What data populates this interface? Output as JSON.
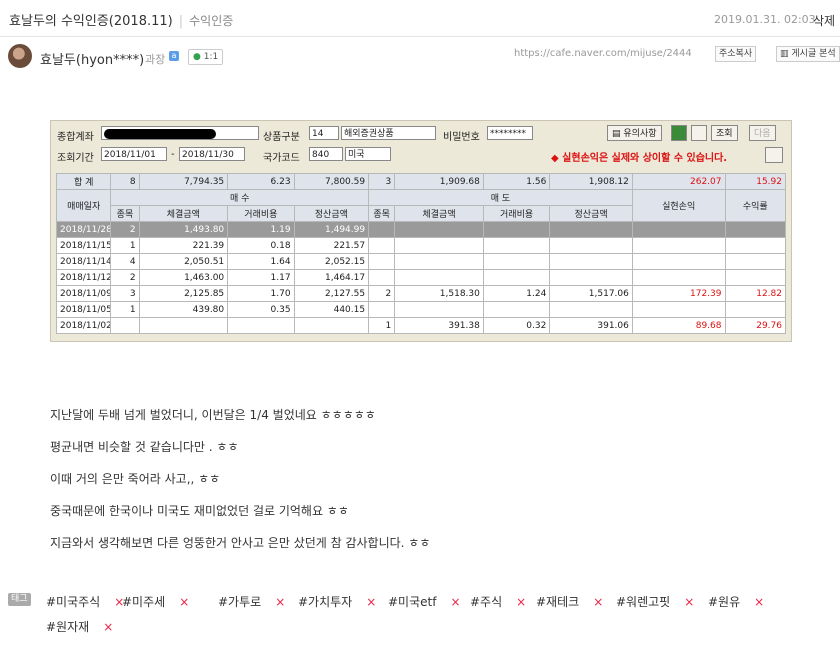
{
  "header": {
    "title": "효날두의 수익인증(2018.11)",
    "category": "수익인증",
    "date": "2019.01.31. 02:03",
    "delete_label": "삭제"
  },
  "author": {
    "name": "효날두(hyon****)",
    "rank": "과장",
    "badge": "a",
    "comment_count": "1:1",
    "url": "https://cafe.naver.com/mijuse/2444",
    "copy_url_label": "주소복사",
    "board_label": "게시글 본석"
  },
  "screenshot": {
    "account_label": "종합계좌",
    "product_label": "상품구분",
    "product_code": "14",
    "product_name": "해외증권상품",
    "password_label": "비밀번호",
    "password_value": "********",
    "notice_button": "유의사항",
    "query_button": "조회",
    "next_button": "다음",
    "period_label": "조회기간",
    "period_from": "2018/11/01",
    "period_to": "2018/11/30",
    "country_label": "국가코드",
    "country_code": "840",
    "country_name": "미국",
    "warning": "◆ 실현손익은 실제와 상이할 수 있습니다.",
    "summary": [
      "합 계",
      "8",
      "7,794.35",
      "6.23",
      "7,800.59",
      "3",
      "1,909.68",
      "1.56",
      "1,908.12",
      "262.07",
      "15.92"
    ],
    "buy_header": "매   수",
    "sell_header": "매   도",
    "col_date": "매매일자",
    "col_count": "종목",
    "col_amount": "체결금액",
    "col_fee": "거래비용",
    "col_settle": "정산금액",
    "col_pnl": "실현손익",
    "col_rate": "수익률",
    "rows": [
      [
        "2018/11/28",
        "2",
        "1,493.80",
        "1.19",
        "1,494.99",
        "",
        "",
        "",
        "",
        "",
        ""
      ],
      [
        "2018/11/15",
        "1",
        "221.39",
        "0.18",
        "221.57",
        "",
        "",
        "",
        "",
        "",
        ""
      ],
      [
        "2018/11/14",
        "4",
        "2,050.51",
        "1.64",
        "2,052.15",
        "",
        "",
        "",
        "",
        "",
        ""
      ],
      [
        "2018/11/12",
        "2",
        "1,463.00",
        "1.17",
        "1,464.17",
        "",
        "",
        "",
        "",
        "",
        ""
      ],
      [
        "2018/11/09",
        "3",
        "2,125.85",
        "1.70",
        "2,127.55",
        "2",
        "1,518.30",
        "1.24",
        "1,517.06",
        "172.39",
        "12.82"
      ],
      [
        "2018/11/05",
        "1",
        "439.80",
        "0.35",
        "440.15",
        "",
        "",
        "",
        "",
        "",
        ""
      ],
      [
        "2018/11/02",
        "",
        "",
        "",
        "",
        "1",
        "391.38",
        "0.32",
        "391.06",
        "89.68",
        "29.76"
      ]
    ]
  },
  "body": {
    "paragraphs": [
      "지난달에 두배 넘게 벌었더니, 이번달은 1/4 벌었네요 ㅎㅎㅎㅎㅎ",
      "평균내면 비슷할 것 같습니다만 . ㅎㅎ",
      "이때 거의 은만 죽어라 사고,, ㅎㅎ",
      "중국때문에 한국이나 미국도 재미없었던 걸로 기억해요 ㅎㅎ",
      "지금와서 생각해보면 다른 엉뚱한거 안사고 은만 샀던게 참 감사합니다. ㅎㅎ"
    ]
  },
  "tags": {
    "label": "태그",
    "items": [
      "#미국주식",
      "#미주세",
      "#가투로",
      "#가치투자",
      "#미국etf",
      "#주식",
      "#재테크",
      "#워렌고핏",
      "#원유",
      "#원자재"
    ],
    "remove_glyph": "×"
  },
  "colors": {
    "loss_profit_red": "#dd1111",
    "selected_row": "#9a9a9a",
    "header_bg": "#dfe3ec"
  }
}
